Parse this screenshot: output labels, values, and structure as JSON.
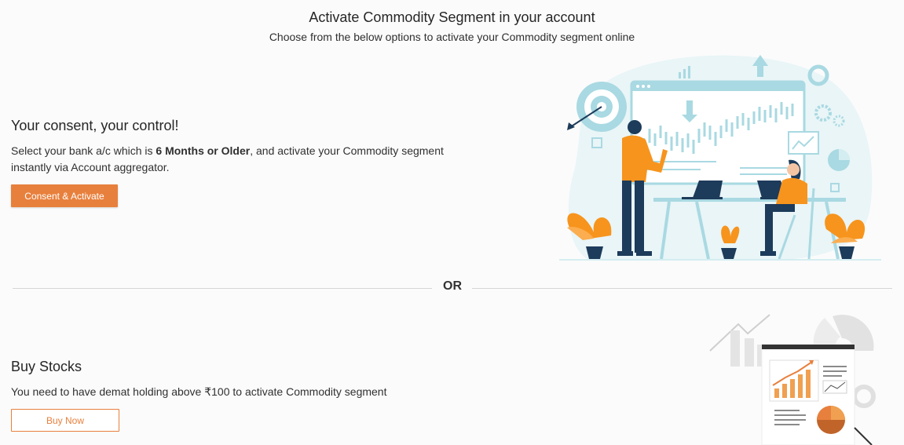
{
  "header": {
    "title": "Activate Commodity Segment in your account",
    "subtitle": "Choose from the below options to activate your Commodity segment online"
  },
  "consent": {
    "title": "Your consent, your control!",
    "desc_before": "Select your bank a/c which is ",
    "desc_bold": "6 Months or Older",
    "desc_after": ", and activate your Commodity segment instantly via Account aggregator.",
    "button": "Consent & Activate"
  },
  "divider": {
    "label": "OR"
  },
  "buy": {
    "title": "Buy Stocks",
    "desc": "You need to have demat holding above ₹100 to activate Commodity segment",
    "button": "Buy Now"
  },
  "colors": {
    "accent": "#e8803d",
    "illustration_blue": "#a9d9e2",
    "illustration_navy": "#1d3b5a"
  },
  "icons": [
    "target-icon",
    "upload-arrow-icon",
    "gear-icon",
    "pie-chart-icon",
    "trend-chart-icon"
  ]
}
